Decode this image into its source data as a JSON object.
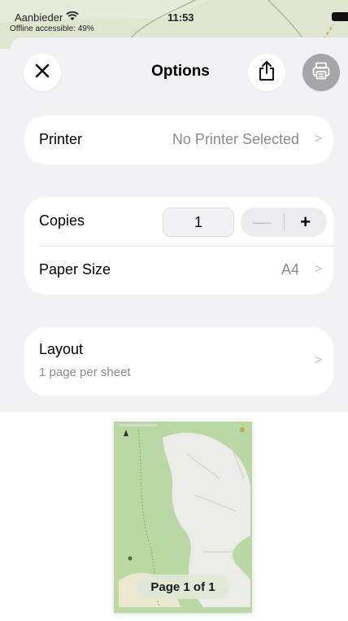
{
  "status_bar": {
    "carrier": "Aanbieder",
    "time": "11:53",
    "offline_note": "Offline accessible: 49%"
  },
  "icons": {
    "wifi": "wifi-icon",
    "battery": "battery-icon",
    "close": "close-icon",
    "share": "share-icon",
    "print": "printer-icon",
    "chevron": "chevron-right-icon"
  },
  "header": {
    "title": "Options"
  },
  "printer_row": {
    "label": "Printer",
    "value": "No Printer Selected",
    "chevron": ">"
  },
  "copies_row": {
    "label": "Copies",
    "count": "1",
    "minus": "—",
    "plus": "+"
  },
  "paper_row": {
    "label": "Paper Size",
    "value": "A4",
    "chevron": ">"
  },
  "layout_row": {
    "label": "Layout",
    "subtitle": "1 page per sheet",
    "chevron": ">"
  },
  "preview": {
    "page_indicator": "Page 1 of 1"
  },
  "colors": {
    "sheet_bg": "#f2f2f4",
    "card_bg": "#ffffff",
    "secondary_text": "#8a8a8e",
    "disabled_button": "#a6a6aa",
    "map_green": "#b7d7a2",
    "map_field": "#ececea"
  }
}
